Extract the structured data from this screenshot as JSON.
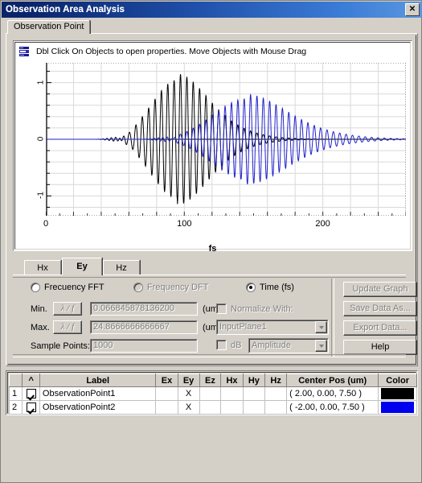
{
  "window": {
    "title": "Observation Area Analysis",
    "close_label": "✕"
  },
  "tabs": [
    {
      "label": "Observation Point",
      "selected": true
    }
  ],
  "graph": {
    "hint_icon": "chart-properties-icon",
    "hint_text": "Dbl Click On Objects to open properties.  Move Objects with Mouse Drag"
  },
  "chart_data": {
    "type": "line",
    "title": "",
    "xlabel": "fs",
    "ylabel": "",
    "xlim": [
      0,
      260
    ],
    "ylim": [
      -1.35,
      1.35
    ],
    "xticks": [
      0,
      100,
      200
    ],
    "xticklabels": [
      "0",
      "100",
      "200"
    ],
    "yticks": [
      -1,
      0,
      1
    ],
    "yticklabels": [
      "-1",
      "0",
      "1"
    ],
    "grid": true,
    "legend": "none",
    "series": [
      {
        "name": "ObservationPoint1",
        "color": "#000000",
        "description": "Black Ey pulse, envelope peak near 95 fs, amplitude ~1.05",
        "envelope_center": 95,
        "envelope_width": 26,
        "peak_amplitude": 1.05,
        "carrier_period": 4.6,
        "onset": 58
      },
      {
        "name": "ObservationPoint2",
        "color": "#2222cc",
        "description": "Blue Ey pulse, envelope peak near 145 fs, amplitude ~0.72, long decaying tail",
        "envelope_center": 145,
        "envelope_width": 34,
        "peak_amplitude": 0.72,
        "carrier_period": 4.6,
        "onset": 92
      }
    ]
  },
  "component_tabs": [
    {
      "label": "Hx",
      "selected": false
    },
    {
      "label": "Ey",
      "selected": true
    },
    {
      "label": "Hz",
      "selected": false
    }
  ],
  "options": {
    "mode_fft": {
      "label": "Frecuency FFT",
      "selected": false,
      "enabled": true
    },
    "mode_dft": {
      "label": "Frequency DFT",
      "selected": false,
      "enabled": false
    },
    "mode_time": {
      "label": "Time (fs)",
      "selected": true,
      "enabled": true
    },
    "min_label": "Min.",
    "max_label": "Max.",
    "lambda_button": "λ / f",
    "min_value": "0.066845878136200",
    "max_value": "24.8666666666667",
    "unit": "(um)",
    "sample_points_label": "Sample Points:",
    "sample_points_value": "1000",
    "normalize_label": "Normalize With:",
    "normalize_checked": false,
    "normalize_source": "InputPlane1",
    "db_label": "dB",
    "db_checked": false,
    "amplitude_value": "Amplitude"
  },
  "buttons": [
    {
      "label": "Update Graph",
      "enabled": false
    },
    {
      "label": "Save Data As...",
      "enabled": false
    },
    {
      "label": "Export Data...",
      "enabled": false
    },
    {
      "label": "Help",
      "enabled": true
    }
  ],
  "table": {
    "headers": [
      "",
      "^",
      "Label",
      "Ex",
      "Ey",
      "Ez",
      "Hx",
      "Hy",
      "Hz",
      "Center Pos (um)",
      "Color"
    ],
    "rows": [
      {
        "num": "1",
        "checked": true,
        "label": "ObservationPoint1",
        "ex": "",
        "ey": "X",
        "ez": "",
        "hx": "",
        "hy": "",
        "hz": "",
        "center_pos": "( 2.00, 0.00, 7.50 )",
        "color": "#000000"
      },
      {
        "num": "2",
        "checked": true,
        "label": "ObservationPoint2",
        "ex": "",
        "ey": "X",
        "ez": "",
        "hx": "",
        "hy": "",
        "hz": "",
        "center_pos": "( -2.00, 0.00, 7.50 )",
        "color": "#0000ee"
      }
    ]
  }
}
